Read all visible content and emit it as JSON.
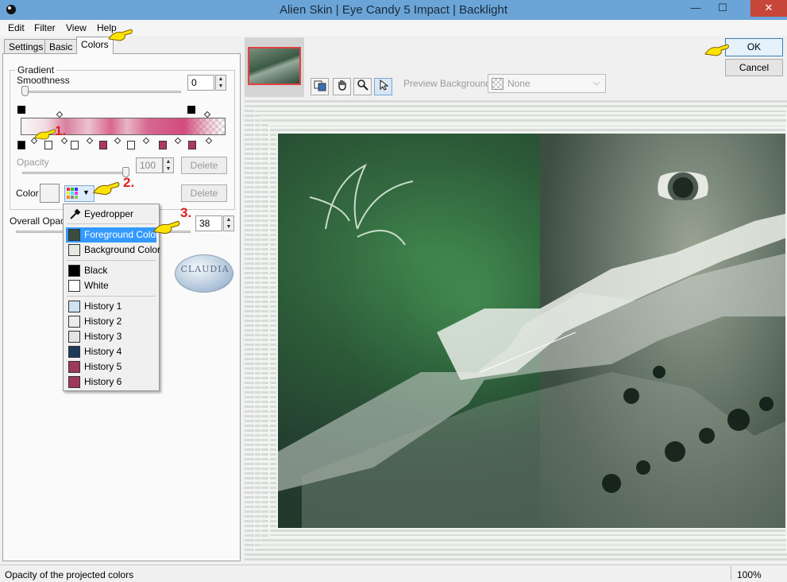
{
  "window": {
    "title": "Alien Skin | Eye Candy 5 Impact | Backlight",
    "minimize_glyph": "—",
    "maximize_glyph": "☐",
    "close_glyph": "✕"
  },
  "menu": [
    "Edit",
    "Filter",
    "View",
    "Help"
  ],
  "tabs": [
    "Settings",
    "Basic",
    "Colors"
  ],
  "active_tab": "Colors",
  "gradient": {
    "group_label": "Gradient",
    "smoothness_label": "Smoothness",
    "smoothness_value": "0",
    "opacity_label": "Opacity",
    "opacity_value": "100",
    "delete_label": "Delete",
    "color_label": "Color",
    "color_delete_label": "Delete"
  },
  "overall_opacity": {
    "label": "Overall Opacity",
    "value": "38"
  },
  "color_menu": {
    "items": [
      {
        "label": "Eyedropper",
        "icon": "eyedropper-icon"
      },
      {
        "label": "Foreground Color",
        "swatch": "#3a4d40",
        "selected": true
      },
      {
        "label": "Background Color",
        "swatch": "#e6e8e0"
      },
      {
        "label": "Black",
        "swatch": "#000000"
      },
      {
        "label": "White",
        "swatch": "#ffffff"
      },
      {
        "label": "History 1",
        "swatch": "#cfe2f3"
      },
      {
        "label": "History 2",
        "swatch": "#ececec"
      },
      {
        "label": "History 3",
        "swatch": "#e4e4e4"
      },
      {
        "label": "History 4",
        "swatch": "#1e3a5c"
      },
      {
        "label": "History 5",
        "swatch": "#a0385e"
      },
      {
        "label": "History 6",
        "swatch": "#a0385e"
      }
    ]
  },
  "watermark_text": "CLAUDIA",
  "annotations": [
    "1.",
    "2.",
    "3."
  ],
  "preview": {
    "background_label": "Preview Background:",
    "background_value": "None"
  },
  "buttons": {
    "ok": "OK",
    "cancel": "Cancel"
  },
  "status": {
    "text": "Opacity of the projected colors",
    "zoom": "100%"
  },
  "colors": {
    "titlebar": "#6ba4d6",
    "gradient_pink": "#d34b7c",
    "selection": "#3399ff"
  }
}
